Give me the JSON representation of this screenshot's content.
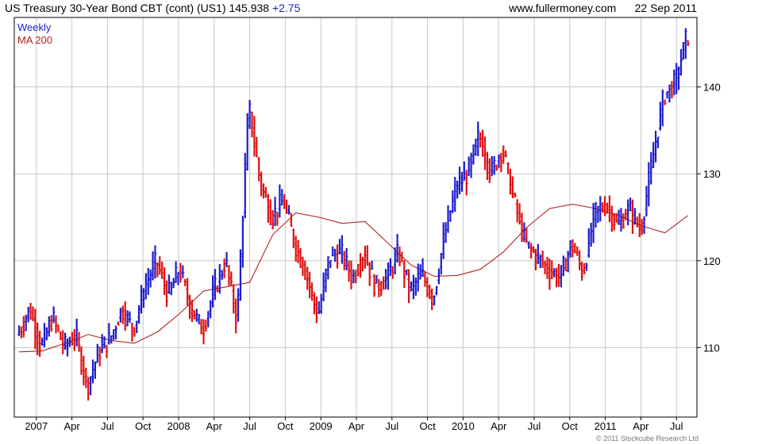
{
  "header": {
    "instrument": "US Treasury 30-Year  Bond CBT (cont) (US1)",
    "last_price": "145.938",
    "change": "+2.75",
    "source": "www.fullermoney.com",
    "date": "22 Sep 2011"
  },
  "legend": {
    "weekly": "Weekly",
    "ma": "MA 200"
  },
  "footer": {
    "copyright": "© 2011 Stockcube Research Ltd"
  },
  "colors": {
    "up_bar": "#1d1dcc",
    "down_bar": "#e01010",
    "ma_line": "#b22222",
    "grid": "#c8c8c8",
    "axis": "#000000"
  },
  "chart_data": {
    "type": "line",
    "series_style": "weekly price bars (blue = up week, red = down week) with 200-period moving average line",
    "y_ticks": [
      110,
      120,
      130,
      140
    ],
    "ylim": [
      102,
      148
    ],
    "x_tick_labels": [
      "2007",
      "Apr",
      "Jul",
      "Oct",
      "2008",
      "Apr",
      "Jul",
      "Oct",
      "2009",
      "Apr",
      "Jul",
      "Oct",
      "2010",
      "Apr",
      "Jul",
      "Oct",
      "2011",
      "Apr",
      "Jul"
    ],
    "x_range": [
      0,
      58.5
    ],
    "grid": true,
    "y_axis_side": "right",
    "series": [
      {
        "name": "Weekly",
        "x": [
          0,
          1,
          2,
          3,
          4,
          5,
          6,
          7,
          8,
          9,
          10,
          11,
          12,
          13,
          14,
          15,
          16,
          17,
          18,
          19,
          20,
          21,
          22,
          23,
          24,
          25,
          26,
          27,
          28,
          29,
          30,
          31,
          32,
          33,
          34,
          35,
          36,
          37,
          38,
          39,
          40,
          41,
          42,
          43,
          44,
          45,
          46,
          47,
          48,
          49,
          50,
          51,
          52,
          53,
          54,
          55,
          56,
          57,
          58
        ],
        "values": [
          111.5,
          114.5,
          110,
          113.5,
          110,
          111.5,
          105.5,
          109.5,
          111,
          114.5,
          112,
          117,
          120,
          116,
          119,
          114.5,
          112,
          116.5,
          120,
          113,
          138,
          129,
          125,
          127,
          122,
          118.5,
          113.5,
          120.5,
          121,
          118,
          121,
          117,
          118,
          121,
          116.5,
          118.5,
          115.5,
          123,
          128.5,
          130,
          134.5,
          130,
          133,
          127,
          122,
          120.5,
          119,
          118,
          122,
          118.5,
          125.5,
          126.5,
          124,
          126,
          123.5,
          131.5,
          139,
          140.5,
          145.9
        ]
      },
      {
        "name": "MA 200",
        "x": [
          0,
          2,
          4,
          6,
          8,
          10,
          12,
          14,
          16,
          18,
          20,
          22,
          24,
          26,
          28,
          30,
          32,
          34,
          36,
          38,
          40,
          42,
          44,
          46,
          48,
          50,
          52,
          54,
          56,
          58
        ],
        "values": [
          109.5,
          109.6,
          110.5,
          111.5,
          110.8,
          110.5,
          111.8,
          114,
          116.5,
          117,
          117.5,
          123,
          125.5,
          125,
          124.3,
          124.5,
          122,
          119.5,
          118.2,
          118.3,
          119,
          121,
          123.8,
          126,
          126.5,
          126,
          125.2,
          124,
          123.2,
          125.2
        ]
      }
    ]
  }
}
